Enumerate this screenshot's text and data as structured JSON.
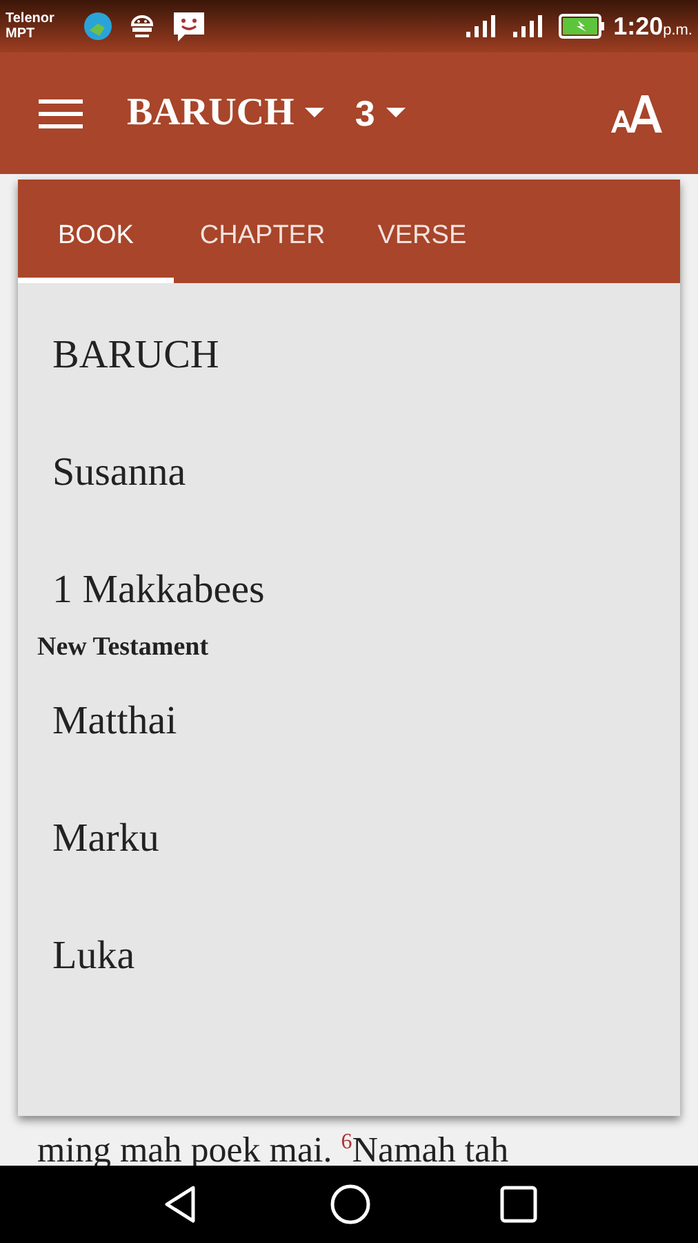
{
  "status_bar": {
    "carrier": [
      "Telenor",
      "MPT"
    ],
    "time": "1:20",
    "period": "p.m."
  },
  "app_bar": {
    "book": "BARUCH",
    "chapter": "3"
  },
  "picker": {
    "tabs": [
      {
        "label": "BOOK",
        "selected": true
      },
      {
        "label": "CHAPTER",
        "selected": false
      },
      {
        "label": "VERSE",
        "selected": false
      }
    ],
    "items": [
      {
        "kind": "book",
        "label": "BARUCH"
      },
      {
        "kind": "book",
        "label": "Susanna"
      },
      {
        "kind": "book",
        "label": "1 Makkabees"
      },
      {
        "kind": "header",
        "label": "New Testament"
      },
      {
        "kind": "book",
        "label": "Matthai"
      },
      {
        "kind": "book",
        "label": "Marku"
      },
      {
        "kind": "book",
        "label": "Luka"
      }
    ]
  },
  "verse_text": "ming mah poek mai. $^{6}$Namah tah"
}
